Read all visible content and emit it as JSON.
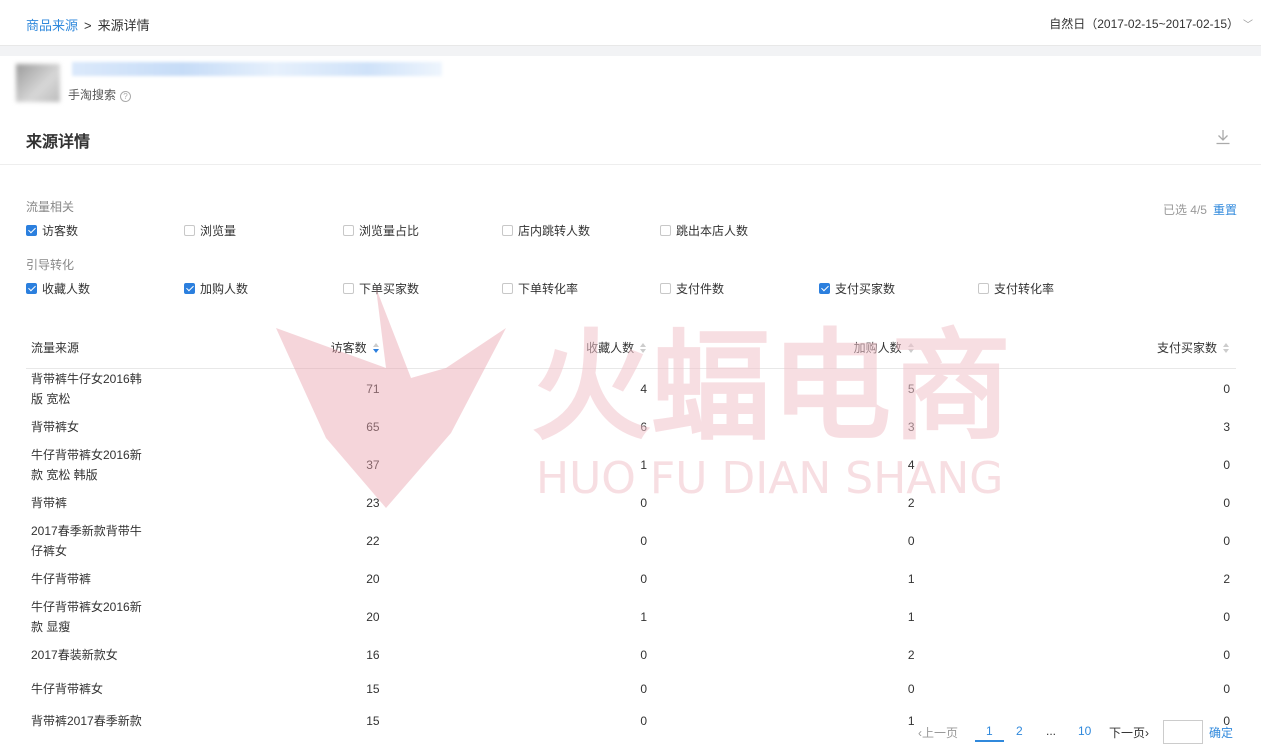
{
  "breadcrumb": {
    "parent": "商品来源",
    "separator": ">",
    "current": "来源详情"
  },
  "date_range": {
    "label": "自然日（2017-02-15~2017-02-15）"
  },
  "product": {
    "source_name": "手淘搜索"
  },
  "section": {
    "title": "来源详情"
  },
  "filters": {
    "traffic": {
      "label": "流量相关",
      "options": [
        {
          "label": "访客数",
          "checked": true
        },
        {
          "label": "浏览量",
          "checked": false
        },
        {
          "label": "浏览量占比",
          "checked": false
        },
        {
          "label": "店内跳转人数",
          "checked": false
        },
        {
          "label": "跳出本店人数",
          "checked": false
        }
      ]
    },
    "conversion": {
      "label": "引导转化",
      "options": [
        {
          "label": "收藏人数",
          "checked": true
        },
        {
          "label": "加购人数",
          "checked": true
        },
        {
          "label": "下单买家数",
          "checked": false
        },
        {
          "label": "下单转化率",
          "checked": false
        },
        {
          "label": "支付件数",
          "checked": false
        },
        {
          "label": "支付买家数",
          "checked": true
        },
        {
          "label": "支付转化率",
          "checked": false
        }
      ]
    },
    "selected_text": "已选 4/5",
    "reset_label": "重置"
  },
  "table": {
    "columns": [
      "流量来源",
      "访客数",
      "收藏人数",
      "加购人数",
      "支付买家数"
    ],
    "rows": [
      {
        "name": "背带裤牛仔女2016韩版 宽松",
        "visitors": "71",
        "favorites": "4",
        "cart": "5",
        "buyers": "0"
      },
      {
        "name": "背带裤女",
        "visitors": "65",
        "favorites": "6",
        "cart": "3",
        "buyers": "3"
      },
      {
        "name": "牛仔背带裤女2016新款 宽松 韩版",
        "visitors": "37",
        "favorites": "1",
        "cart": "4",
        "buyers": "0"
      },
      {
        "name": "背带裤",
        "visitors": "23",
        "favorites": "0",
        "cart": "2",
        "buyers": "0"
      },
      {
        "name": "2017春季新款背带牛仔裤女",
        "visitors": "22",
        "favorites": "0",
        "cart": "0",
        "buyers": "0"
      },
      {
        "name": "牛仔背带裤",
        "visitors": "20",
        "favorites": "0",
        "cart": "1",
        "buyers": "2"
      },
      {
        "name": "牛仔背带裤女2016新款 显瘦",
        "visitors": "20",
        "favorites": "1",
        "cart": "1",
        "buyers": "0"
      },
      {
        "name": "2017春装新款女",
        "visitors": "16",
        "favorites": "0",
        "cart": "2",
        "buyers": "0"
      },
      {
        "name": "牛仔背带裤女",
        "visitors": "15",
        "favorites": "0",
        "cart": "0",
        "buyers": "0"
      },
      {
        "name": "背带裤2017春季新款",
        "visitors": "15",
        "favorites": "0",
        "cart": "1",
        "buyers": "0"
      }
    ]
  },
  "pagination": {
    "prev": "上一页",
    "pages": [
      "1",
      "2",
      "...",
      "10"
    ],
    "next": "下一页",
    "confirm": "确定"
  },
  "watermark": {
    "cn": "火蝠电商",
    "en": "HUO FU DIAN SHANG"
  },
  "colors": {
    "accent": "#3089dc",
    "checkbox": "#2b7fde",
    "watermark": "#f2c4cc"
  }
}
